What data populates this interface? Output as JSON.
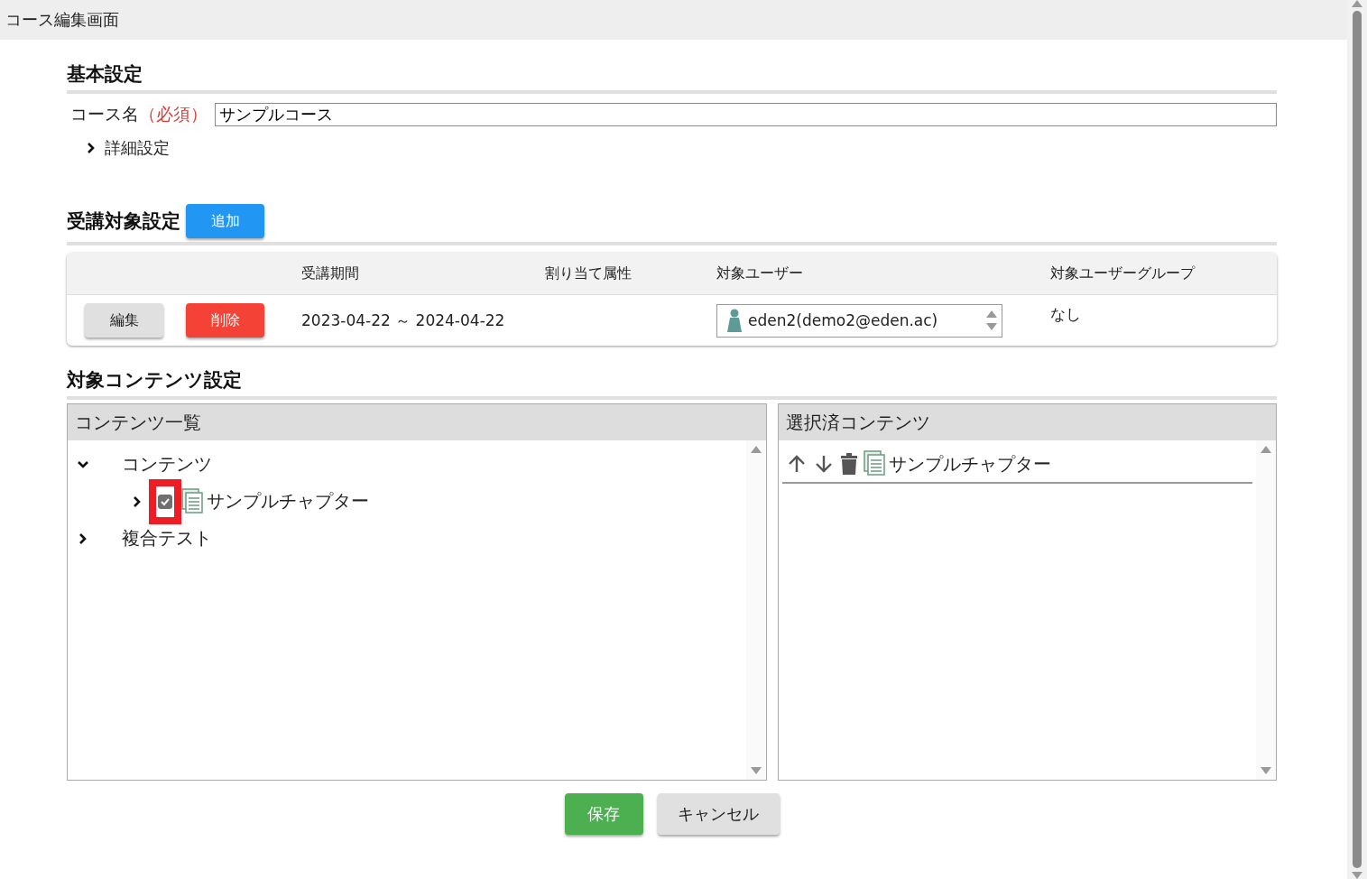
{
  "window": {
    "title": "コース編集画面"
  },
  "basic": {
    "heading": "基本設定",
    "course_name_label": "コース名",
    "required_mark": "（必須）",
    "course_name": "サンプルコース",
    "details": {
      "label": "詳細設定",
      "expanded": false
    }
  },
  "audience": {
    "heading": "受講対象設定",
    "add_button": "追加",
    "columns": [
      "受講期間",
      "割り当て属性",
      "対象ユーザー",
      "対象ユーザーグループ"
    ],
    "rows": [
      {
        "edit_button": "編集",
        "delete_button": "削除",
        "period": "2023-04-22 ～ 2024-04-22",
        "users": [
          "eden2(demo2@eden.ac)"
        ],
        "groups": "なし"
      }
    ]
  },
  "contents": {
    "heading": "対象コンテンツ設定",
    "list": {
      "title": "コンテンツ一覧",
      "tree": [
        {
          "label": "コンテンツ",
          "kind": "folder",
          "expanded": true,
          "children": [
            {
              "label": "サンプルチャプター",
              "kind": "chapter",
              "expanded": false,
              "checked": true,
              "highlighted": true
            }
          ]
        },
        {
          "label": "複合テスト",
          "kind": "folder",
          "expanded": false
        }
      ]
    },
    "selected": {
      "title": "選択済コンテンツ",
      "items": [
        {
          "label": "サンプルチャプター"
        }
      ]
    }
  },
  "buttons": [
    {
      "label": "保存",
      "kind": "primary"
    },
    {
      "label": "キャンセル",
      "kind": "secondary"
    }
  ]
}
